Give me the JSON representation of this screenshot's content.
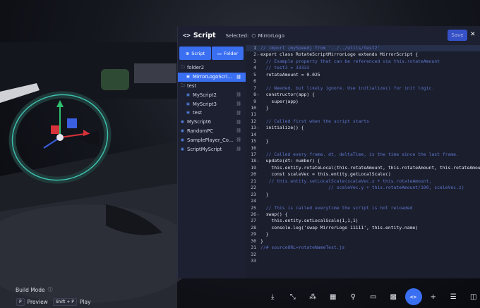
{
  "header": {
    "title_icon": "code-brackets-icon",
    "title": "Script",
    "selected_label": "Selected:",
    "selected_entity": "MirrorLogo",
    "save_label": "Save",
    "close_glyph": "✕"
  },
  "sidebar": {
    "script_button": "Script",
    "folder_button": "Folder",
    "items": [
      {
        "label": "folder2",
        "type": "folder",
        "indent": 0,
        "selected": false,
        "linked": false
      },
      {
        "label": "MirrorLogoScri...",
        "type": "file",
        "indent": 1,
        "selected": true,
        "linked": true
      },
      {
        "label": "test",
        "type": "folder",
        "indent": 0,
        "selected": false,
        "linked": false
      },
      {
        "label": "MyScript2",
        "type": "file",
        "indent": 1,
        "selected": false,
        "linked": true
      },
      {
        "label": "MyScript3",
        "type": "file",
        "indent": 1,
        "selected": false,
        "linked": true
      },
      {
        "label": "test",
        "type": "file",
        "indent": 1,
        "selected": false,
        "linked": true
      },
      {
        "label": "MyScript6",
        "type": "file",
        "indent": 0,
        "selected": false,
        "linked": true
      },
      {
        "label": "RandomPC",
        "type": "file",
        "indent": 0,
        "selected": false,
        "linked": true
      },
      {
        "label": "SamplePlayer_Co...",
        "type": "file",
        "indent": 0,
        "selected": false,
        "linked": true
      },
      {
        "label": "ScriptMyScript",
        "type": "file",
        "indent": 0,
        "selected": false,
        "linked": true
      }
    ]
  },
  "editor": {
    "lines": [
      {
        "n": "1",
        "text": "// import {mySpeed} from '../../utils/test2'",
        "comment": true,
        "fold": false
      },
      {
        "n": "2",
        "text": "export class RotateScriptMirrorLogo extends MirrorScript {",
        "comment": false,
        "fold": true
      },
      {
        "n": "3",
        "text": "  // Example property that can be referenced via this.rotateAmount",
        "comment": true,
        "fold": false
      },
      {
        "n": "4",
        "text": "  // test3 = 33333",
        "comment": true,
        "fold": false
      },
      {
        "n": "5",
        "text": "  rotateAmount = 0.025",
        "comment": false,
        "fold": false
      },
      {
        "n": "6",
        "text": "",
        "comment": false,
        "fold": false
      },
      {
        "n": "7",
        "text": "  // Needed, but likely ignore. Use initialize() for init logic.",
        "comment": true,
        "fold": false
      },
      {
        "n": "8",
        "text": "  constructor(app) {",
        "comment": false,
        "fold": true
      },
      {
        "n": "9",
        "text": "    super(app)",
        "comment": false,
        "fold": false
      },
      {
        "n": "10",
        "text": "  }",
        "comment": false,
        "fold": false
      },
      {
        "n": "11",
        "text": "",
        "comment": false,
        "fold": false
      },
      {
        "n": "12",
        "text": "  // Called first when the script starts",
        "comment": true,
        "fold": false
      },
      {
        "n": "13",
        "text": "  initialize() {",
        "comment": false,
        "fold": true
      },
      {
        "n": "14",
        "text": "",
        "comment": false,
        "fold": false
      },
      {
        "n": "15",
        "text": "  }",
        "comment": false,
        "fold": false
      },
      {
        "n": "16",
        "text": "",
        "comment": false,
        "fold": false
      },
      {
        "n": "17",
        "text": "  // Called every frame. dt, deltaTime, is the time since the last frame.",
        "comment": true,
        "fold": false
      },
      {
        "n": "18",
        "text": "  update(dt: number) {",
        "comment": false,
        "fold": true
      },
      {
        "n": "19",
        "text": "    this.entity.rotateLocal(this.rotateAmount, this.rotateAmount, this.rotateAmount)",
        "comment": false,
        "fold": false
      },
      {
        "n": "20",
        "text": "    const scaleVec = this.entity.getLocalScale()",
        "comment": false,
        "fold": false
      },
      {
        "n": "21",
        "text": "   // this.entity.setLocalScale(scaleVec.x + this.rotateAmount,",
        "comment": true,
        "fold": false
      },
      {
        "n": "22",
        "text": "                         // scaleVec.y + this.rotateAmount/100, scaleVec.z)",
        "comment": true,
        "fold": false
      },
      {
        "n": "23",
        "text": "  }",
        "comment": false,
        "fold": false
      },
      {
        "n": "24",
        "text": "",
        "comment": false,
        "fold": false
      },
      {
        "n": "25",
        "text": "  // This is called everytime the script is hot reloaded",
        "comment": true,
        "fold": false
      },
      {
        "n": "26",
        "text": "  swap() {",
        "comment": false,
        "fold": true
      },
      {
        "n": "27",
        "text": "    this.entity.setLocalScale(1,1,1)",
        "comment": false,
        "fold": false
      },
      {
        "n": "28",
        "text": "    console.log('swap MirrorLogo 11111', this.entity.name)",
        "comment": false,
        "fold": false
      },
      {
        "n": "29",
        "text": "  }",
        "comment": false,
        "fold": false
      },
      {
        "n": "30",
        "text": "}",
        "comment": false,
        "fold": false
      },
      {
        "n": "31",
        "text": "//# sourceURL=rotateNameTest.js",
        "comment": true,
        "fold": false
      },
      {
        "n": "32",
        "text": "",
        "comment": false,
        "fold": false
      },
      {
        "n": "33",
        "text": "",
        "comment": false,
        "fold": false
      }
    ]
  },
  "hud": {
    "build_mode_label": "Build Mode",
    "preview_key": "P",
    "preview_label": "Preview",
    "play_key": "Shift + P",
    "play_label": "Play"
  },
  "toolbar": {
    "tools": [
      {
        "name": "transform-tool-icon",
        "glyph": "⤓"
      },
      {
        "name": "move-tool-icon",
        "glyph": "⤡"
      },
      {
        "name": "group-tool-icon",
        "glyph": "⁂"
      },
      {
        "name": "grid-tool-icon",
        "glyph": "▦"
      },
      {
        "name": "light-bulb-icon",
        "glyph": "⚲"
      },
      {
        "name": "camera-icon",
        "glyph": "▭"
      },
      {
        "name": "assets-icon",
        "glyph": "▩"
      },
      {
        "name": "code-editor-icon",
        "glyph": "<>",
        "active": true
      },
      {
        "name": "add-icon",
        "glyph": "+"
      },
      {
        "name": "list-icon",
        "glyph": "☰"
      },
      {
        "name": "gallery-icon",
        "glyph": "◫"
      }
    ]
  },
  "colors": {
    "accent": "#3a6ff2",
    "panel_bg": "#1c2030",
    "editor_bg": "#1a1e2d",
    "comment": "#5e74c9"
  }
}
